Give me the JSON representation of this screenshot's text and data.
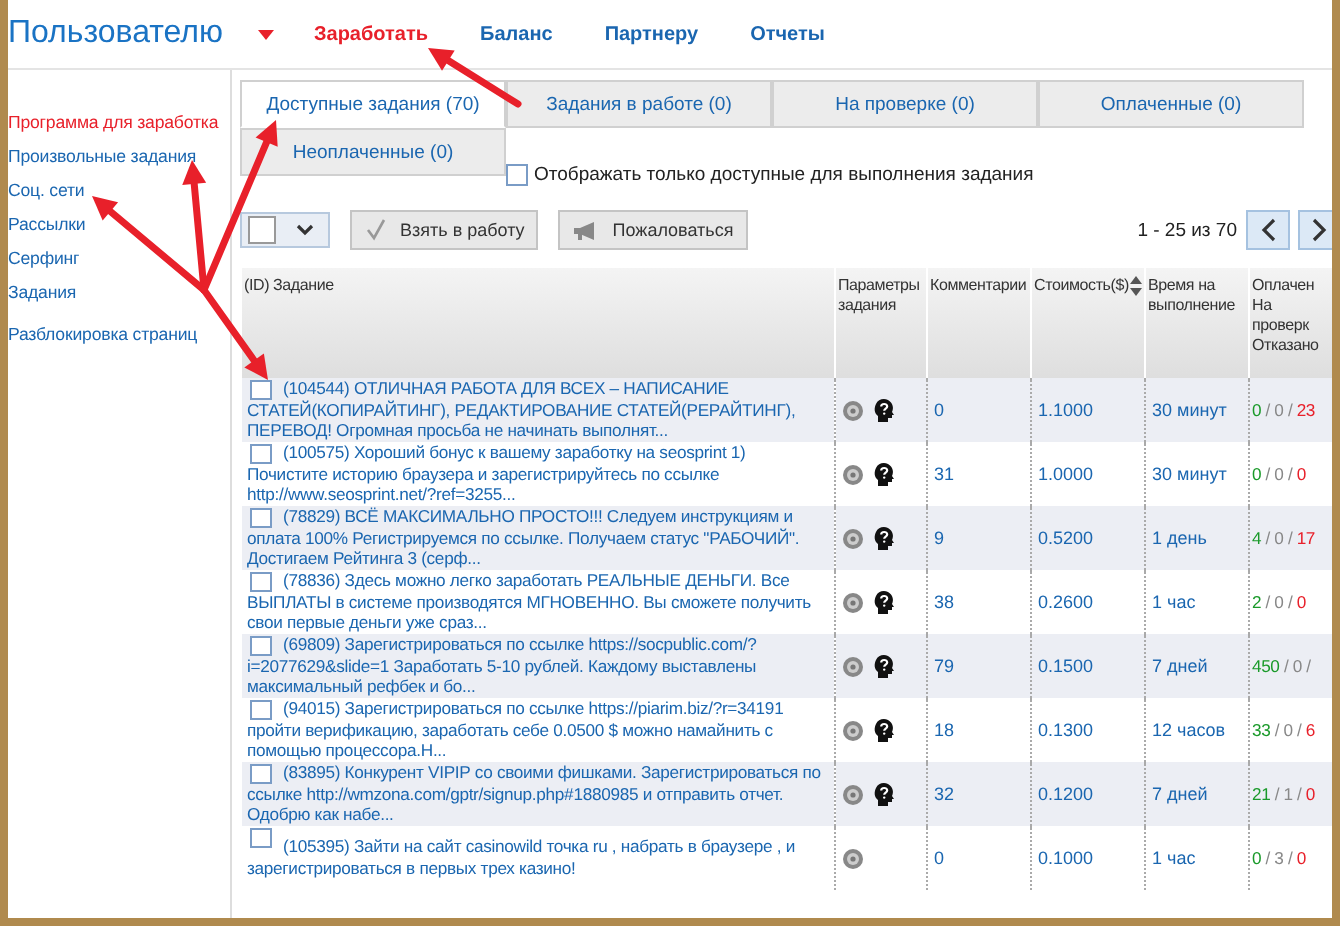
{
  "header": {
    "title": "Пользователю",
    "nav": [
      {
        "label": "Заработать",
        "selected": true
      },
      {
        "label": "Баланс",
        "selected": false
      },
      {
        "label": "Партнеру",
        "selected": false
      },
      {
        "label": "Отчеты",
        "selected": false
      }
    ]
  },
  "sidebar": {
    "items": [
      {
        "label": "Программа для заработка",
        "selected": true
      },
      {
        "label": "Произвольные задания",
        "selected": false
      },
      {
        "label": "Соц. сети",
        "selected": false
      },
      {
        "label": "Рассылки",
        "selected": false
      },
      {
        "label": "Серфинг",
        "selected": false
      },
      {
        "label": "Задания",
        "selected": false
      }
    ],
    "extra": "Разблокировка страниц"
  },
  "tabs": [
    {
      "label": "Доступные задания (70)",
      "selected": true
    },
    {
      "label": "Задания в работе (0)",
      "selected": false
    },
    {
      "label": "На проверке (0)",
      "selected": false
    },
    {
      "label": "Оплаченные (0)",
      "selected": false
    },
    {
      "label": "Неоплаченные (0)",
      "selected": false
    }
  ],
  "filter": {
    "label": "Отображать только доступные для выполнения задания",
    "checked": false
  },
  "toolbar": {
    "take": "Взять в работу",
    "complain": "Пожаловаться",
    "pager": "1 - 25 из 70"
  },
  "table": {
    "columns": [
      [
        "(ID) Задание"
      ],
      [
        "Параметры",
        "задания"
      ],
      [
        "Комментарии"
      ],
      [
        "Стоимость($)"
      ],
      [
        "Время на",
        "выполнение"
      ],
      [
        "Оплачен",
        "На",
        "проверк",
        "Отказано"
      ]
    ],
    "rows": [
      {
        "task": "(104544) ОТЛИЧНАЯ РАБОТА ДЛЯ ВСЕХ – НАПИСАНИЕ СТАТЕЙ(КОПИРАЙТИНГ), РЕДАКТИРОВАНИЕ СТАТЕЙ(РЕРАЙТИНГ), ПЕРЕВОД! Огромная просьба не начинать выполнят...",
        "checked": false,
        "params": [
          {
            "kind": "target"
          },
          {
            "kind": "help"
          }
        ],
        "comments": "0",
        "cost": "1.1000",
        "time": "30 минут",
        "stats": "0 / 0 / 23"
      },
      {
        "task": "(100575) Хороший бонус к вашему заработку на seosprint 1) Почистите историю браузера и зарегистрируйтесь по ссылке http://www.seosprint.net/?ref=3255...",
        "checked": false,
        "params": [
          {
            "kind": "target"
          },
          {
            "kind": "help"
          }
        ],
        "comments": "31",
        "cost": "1.0000",
        "time": "30 минут",
        "stats": "0 / 0 / 0"
      },
      {
        "task": "(78829) ВСЁ МАКСИМАЛЬНО ПРОСТО!!! Следуем инструкциям и оплата 100% Регистрируемся по ссылке. Получаем статус \"РАБОЧИЙ\". Достигаем Рейтинга 3 (серф...",
        "checked": false,
        "params": [
          {
            "kind": "target"
          },
          {
            "kind": "help"
          }
        ],
        "comments": "9",
        "cost": "0.5200",
        "time": "1 день",
        "stats": "4 / 0 / 17"
      },
      {
        "task": "(78836) Здесь можно легко заработать РЕАЛЬНЫЕ ДЕНЬГИ. Все ВЫПЛАТЫ в системе производятся МГНОВЕННО. Вы сможете получить свои первые деньги уже сраз...",
        "checked": false,
        "params": [
          {
            "kind": "target"
          },
          {
            "kind": "help"
          }
        ],
        "comments": "38",
        "cost": "0.2600",
        "time": "1 час",
        "stats": "2 / 0 / 0"
      },
      {
        "task": "(69809) Зарегистрироваться по ссылке https://socpublic.com/?i=2077629&slide=1 Заработать 5-10 рублей. Каждому выставлены максимальный рефбек и бо...",
        "checked": false,
        "params": [
          {
            "kind": "target"
          },
          {
            "kind": "help"
          }
        ],
        "comments": "79",
        "cost": "0.1500",
        "time": "7 дней",
        "stats": "450 / 0 /"
      },
      {
        "task": "(94015) Зарегистрироваться по ссылке https://piarim.biz/?r=34191 пройти верификацию, заработать себе 0.0500 $ можно намайнить с помощью процессора.Н...",
        "checked": false,
        "params": [
          {
            "kind": "target"
          },
          {
            "kind": "help"
          }
        ],
        "comments": "18",
        "cost": "0.1300",
        "time": "12 часов",
        "stats": "33 / 0 / 6"
      },
      {
        "task": "(83895) Конкурент VIPIP со своими фишками. Зарегистрироваться по ссылке http://wmzona.com/gptr/signup.php#1880985 и отправить отчет. Одобрю как набе...",
        "checked": false,
        "params": [
          {
            "kind": "target"
          },
          {
            "kind": "help"
          }
        ],
        "comments": "32",
        "cost": "0.1200",
        "time": "7 дней",
        "stats": "21 / 1 / 0"
      },
      {
        "task": "(105395) Зайти на сайт casinowild точка ru , набрать в браузере , и зарегистрироваться в первых трех казино!",
        "checked": false,
        "params": [
          {
            "kind": "target"
          }
        ],
        "comments": "0",
        "cost": "0.1000",
        "time": "1 час",
        "stats": "0 / 3 / 0"
      }
    ]
  }
}
